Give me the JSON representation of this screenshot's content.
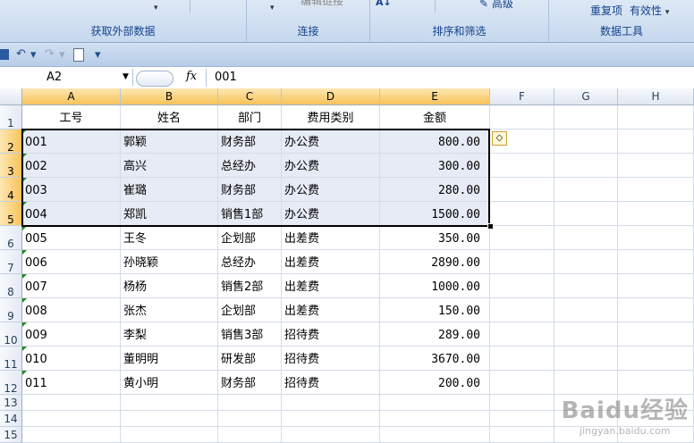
{
  "ribbon": {
    "groups": [
      {
        "label": "获取外部数据"
      },
      {
        "label": "连接",
        "top": "编辑链接"
      },
      {
        "label": "排序和筛选",
        "top": "高级"
      },
      {
        "label": "数据工具",
        "top_items": [
          "重复项",
          "有效性"
        ]
      }
    ]
  },
  "formula_bar": {
    "name_box": "A2",
    "fx": "fx",
    "value": "001"
  },
  "columns": [
    "A",
    "B",
    "C",
    "D",
    "E",
    "F",
    "G",
    "H"
  ],
  "rows": [
    "1",
    "2",
    "3",
    "4",
    "5",
    "6",
    "7",
    "8",
    "9",
    "10",
    "11",
    "12",
    "13",
    "14",
    "15"
  ],
  "table": {
    "headers": [
      "工号",
      "姓名",
      "部门",
      "费用类别",
      "金额"
    ],
    "records": [
      [
        "001",
        "郭颖",
        "财务部",
        "办公费",
        "800.00"
      ],
      [
        "002",
        "高兴",
        "总经办",
        "办公费",
        "300.00"
      ],
      [
        "003",
        "崔璐",
        "财务部",
        "办公费",
        "280.00"
      ],
      [
        "004",
        "郑凯",
        "销售1部",
        "办公费",
        "1500.00"
      ],
      [
        "005",
        "王冬",
        "企划部",
        "出差费",
        "350.00"
      ],
      [
        "006",
        "孙晓颖",
        "总经办",
        "出差费",
        "2890.00"
      ],
      [
        "007",
        "杨杨",
        "销售2部",
        "出差费",
        "1000.00"
      ],
      [
        "008",
        "张杰",
        "企划部",
        "出差费",
        "150.00"
      ],
      [
        "009",
        "李梨",
        "销售3部",
        "招待费",
        "289.00"
      ],
      [
        "010",
        "董明明",
        "研发部",
        "招待费",
        "3670.00"
      ],
      [
        "011",
        "黄小明",
        "财务部",
        "招待费",
        "200.00"
      ]
    ]
  },
  "watermark": {
    "brand": "Baidu经验",
    "url": "jingyan.baidu.com"
  }
}
